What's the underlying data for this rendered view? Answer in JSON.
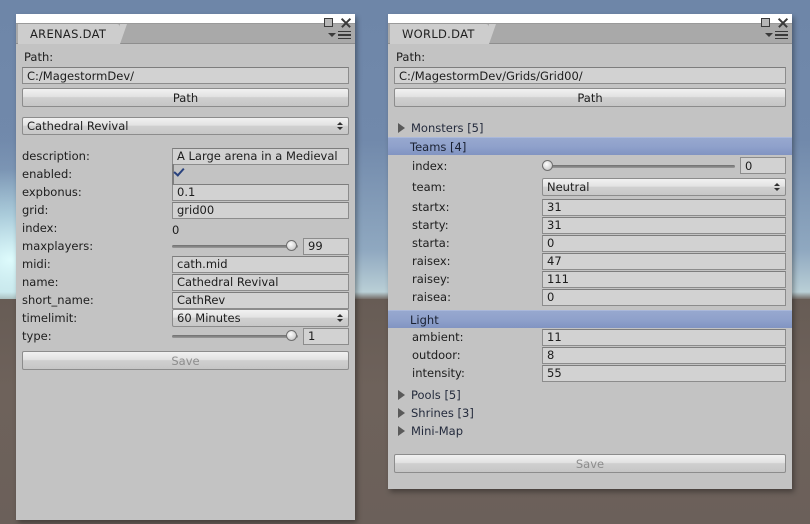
{
  "scene": {
    "sky_color": "#7189ab",
    "ground_color": "#6b605a",
    "glow_color": "#e1ffff"
  },
  "windows": [
    {
      "id": "arenas",
      "tab_label": "ARENAS.DAT",
      "controls": {
        "maximize": "maximize-icon",
        "close": "close-icon",
        "menu": "panel-menu-icon"
      },
      "path_label": "Path:",
      "path_value": "C:/MagestormDev/",
      "path_button": "Path",
      "selector": {
        "value": "Cathedral Revival"
      },
      "fields": [
        {
          "name": "description:",
          "type": "text",
          "value": "A Large arena in a Medieval"
        },
        {
          "name": "enabled:",
          "type": "checkbox",
          "value": true
        },
        {
          "name": "expbonus:",
          "type": "text",
          "value": "0.1"
        },
        {
          "name": "grid:",
          "type": "text",
          "value": "grid00"
        },
        {
          "name": "index:",
          "type": "plain",
          "value": "0"
        },
        {
          "name": "maxplayers:",
          "type": "slider",
          "value": "99",
          "fill": 100
        },
        {
          "name": "midi:",
          "type": "text",
          "value": "cath.mid"
        },
        {
          "name": "name:",
          "type": "text",
          "value": "Cathedral Revival"
        },
        {
          "name": "short_name:",
          "type": "text",
          "value": "CathRev"
        },
        {
          "name": "timelimit:",
          "type": "dropdown",
          "value": "60 Minutes"
        },
        {
          "name": "type:",
          "type": "slider",
          "value": "1",
          "fill": 100
        }
      ],
      "save_button": "Save",
      "save_enabled": false
    },
    {
      "id": "world",
      "tab_label": "WORLD.DAT",
      "controls": {
        "maximize": "maximize-icon",
        "close": "close-icon",
        "menu": "panel-menu-icon"
      },
      "path_label": "Path:",
      "path_value": "C:/MagestormDev/Grids/Grid00/",
      "path_button": "Path",
      "tree": [
        {
          "kind": "foldout",
          "label": "Monsters [5]",
          "expanded": false
        },
        {
          "kind": "section",
          "label": "Teams [4]",
          "selected": true
        },
        {
          "kind": "field",
          "name": "index:",
          "type": "slider",
          "value": "0",
          "fill": 0
        },
        {
          "kind": "field",
          "name": "team:",
          "type": "dropdown",
          "value": "Neutral"
        },
        {
          "kind": "field",
          "name": "startx:",
          "type": "text",
          "value": "31"
        },
        {
          "kind": "field",
          "name": "starty:",
          "type": "text",
          "value": "31"
        },
        {
          "kind": "field",
          "name": "starta:",
          "type": "text",
          "value": "0"
        },
        {
          "kind": "field",
          "name": "raisex:",
          "type": "text",
          "value": "47"
        },
        {
          "kind": "field",
          "name": "raisey:",
          "type": "text",
          "value": "111"
        },
        {
          "kind": "field",
          "name": "raisea:",
          "type": "text",
          "value": "0"
        },
        {
          "kind": "section",
          "label": "Light",
          "selected": false
        },
        {
          "kind": "field",
          "name": "ambient:",
          "type": "text",
          "value": "11"
        },
        {
          "kind": "field",
          "name": "outdoor:",
          "type": "text",
          "value": "8"
        },
        {
          "kind": "field",
          "name": "intensity:",
          "type": "text",
          "value": "55"
        },
        {
          "kind": "foldout",
          "label": "Pools [5]",
          "expanded": false
        },
        {
          "kind": "foldout",
          "label": "Shrines [3]",
          "expanded": false
        },
        {
          "kind": "foldout",
          "label": "Mini-Map",
          "expanded": false
        }
      ],
      "save_button": "Save",
      "save_enabled": false
    }
  ]
}
